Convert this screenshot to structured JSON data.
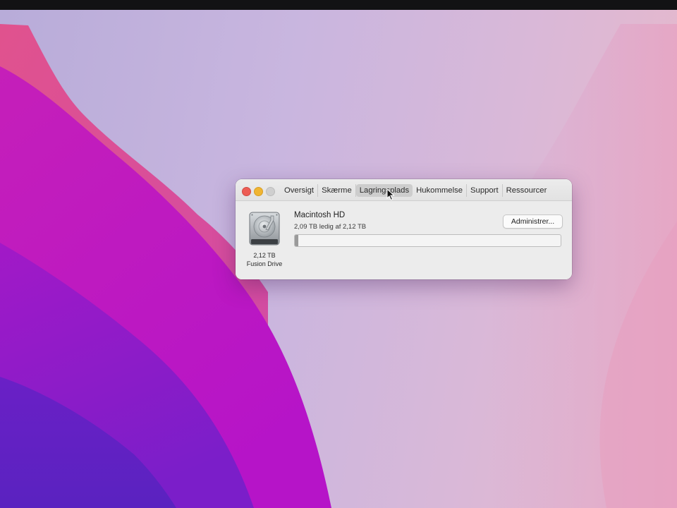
{
  "window": {
    "tabs": [
      {
        "label": "Oversigt"
      },
      {
        "label": "Skærme"
      },
      {
        "label": "Lagringsplads",
        "active": true
      },
      {
        "label": "Hukommelse"
      },
      {
        "label": "Support"
      },
      {
        "label": "Ressourcer"
      }
    ]
  },
  "storage": {
    "disk_size": "2,12 TB",
    "disk_type": "Fusion Drive",
    "volume_name": "Macintosh HD",
    "free_text": "2,09 TB ledig af 2,12 TB",
    "used_fraction": 0.014,
    "manage_label": "Administrer..."
  },
  "colors": {
    "close": "#ed5d55",
    "minimize": "#f0b532",
    "zoom_disabled": "#cfcfcf",
    "wallpaper_magenta": "#c21fb6",
    "wallpaper_purple": "#7a1fc4"
  },
  "icons": [
    "hard-drive-icon",
    "pointer-cursor-icon"
  ]
}
